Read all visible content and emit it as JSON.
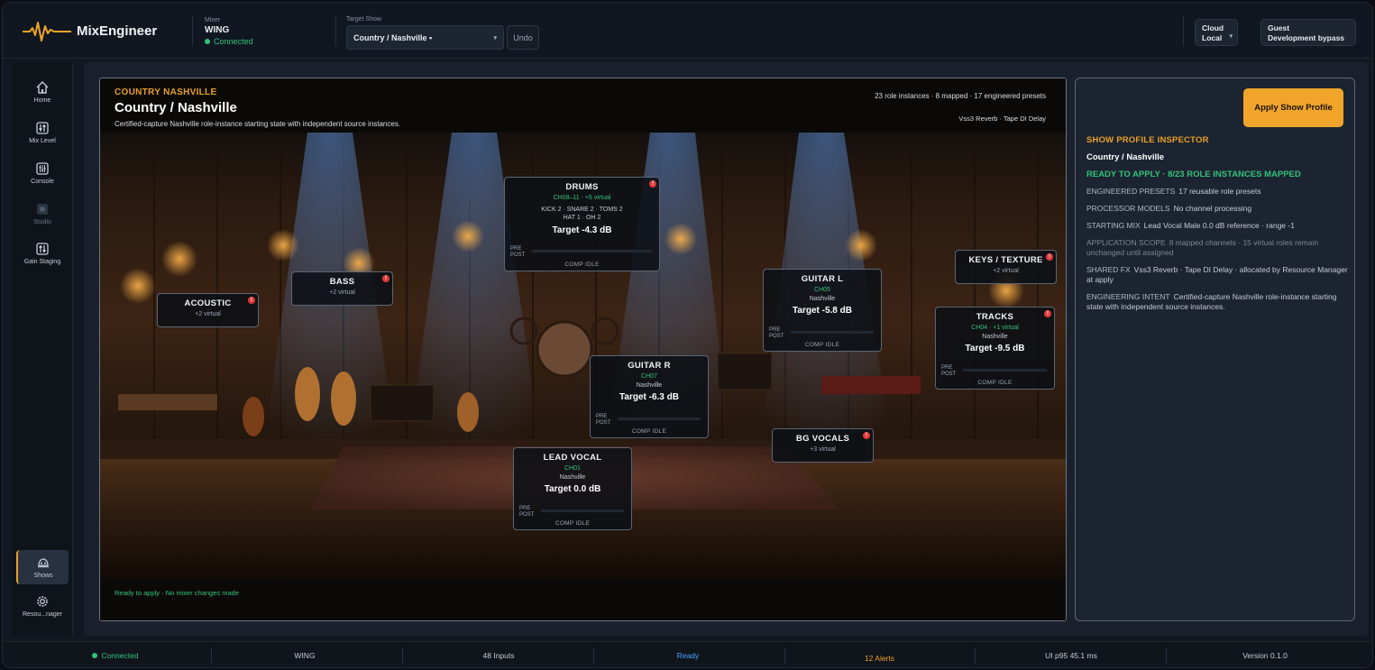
{
  "app": {
    "name": "MixEngineer"
  },
  "mixer": {
    "label": "Mixer",
    "name": "WING",
    "status": "Connected"
  },
  "target": {
    "label": "Target Show",
    "value": "Country / Nashville •",
    "undo": "Undo"
  },
  "cloud": {
    "line1": "Cloud",
    "line2": "Local"
  },
  "user": {
    "line1": "Guest",
    "line2": "Development bypass"
  },
  "sidebar": {
    "items": [
      {
        "label": "Home",
        "icon": "home-icon"
      },
      {
        "label": "Mix Level",
        "icon": "mix-level-icon"
      },
      {
        "label": "Console",
        "icon": "console-icon"
      },
      {
        "label": "Studio",
        "icon": "studio-icon"
      },
      {
        "label": "Gain Staging",
        "icon": "gain-staging-icon"
      },
      {
        "label": "Shows",
        "icon": "shows-icon"
      },
      {
        "label": "Resou...nager",
        "icon": "gear-icon"
      }
    ]
  },
  "show": {
    "genre": "COUNTRY NASHVILLE",
    "title": "Country / Nashville",
    "description": "Certified-capture Nashville role-instance starting state with independent source instances.",
    "stats": "23 role instances · 8 mapped · 17 engineered presets",
    "fx": "Vss3 Reverb · Tape DI Delay",
    "footer": "Ready to apply · No mixer changes made"
  },
  "roles": {
    "drums": {
      "name": "DRUMS",
      "channel": "CH08–11 · +5 virtual",
      "instances1": "KICK 2 · SNARE 2 · TOMS 2",
      "instances2": "HAT 1 · OH 2",
      "target": "Target -4.3 dB",
      "pre": "PRE",
      "post": "POST",
      "comp": "COMP IDLE",
      "alert": "!"
    },
    "bass": {
      "name": "BASS",
      "sub": "+2 virtual",
      "alert": "!"
    },
    "acoustic": {
      "name": "ACOUSTIC",
      "sub": "+2 virtual",
      "alert": "!"
    },
    "guitar_l": {
      "name": "GUITAR L",
      "channel": "CH05",
      "region": "Nashville",
      "target": "Target -5.8 dB",
      "pre": "PRE",
      "post": "POST",
      "comp": "COMP IDLE"
    },
    "keys": {
      "name": "KEYS / TEXTURE",
      "sub": "+2 virtual",
      "alert": "!"
    },
    "tracks": {
      "name": "TRACKS",
      "channel": "CH04 · +1 virtual",
      "region": "Nashville",
      "target": "Target -9.5 dB",
      "pre": "PRE",
      "post": "POST",
      "comp": "COMP IDLE",
      "alert": "!"
    },
    "guitar_r": {
      "name": "GUITAR R",
      "channel": "CH07",
      "region": "Nashville",
      "target": "Target -6.3 dB",
      "pre": "PRE",
      "post": "POST",
      "comp": "COMP IDLE"
    },
    "bg_vocals": {
      "name": "BG VOCALS",
      "sub": "+3 virtual",
      "alert": "!"
    },
    "lead_vocal": {
      "name": "LEAD VOCAL",
      "channel": "CH01",
      "region": "Nashville",
      "target": "Target 0.0 dB",
      "pre": "PRE",
      "post": "POST",
      "comp": "COMP IDLE"
    }
  },
  "inspector": {
    "apply": "Apply Show Profile",
    "heading": "SHOW PROFILE INSPECTOR",
    "name": "Country / Nashville",
    "ready": "READY TO APPLY · 8/23 ROLE INSTANCES MAPPED",
    "presets_k": "ENGINEERED PRESETS",
    "presets_v": "17 reusable role presets",
    "processor_k": "PROCESSOR MODELS",
    "processor_v": "No channel processing",
    "mix_k": "STARTING MIX",
    "mix_v": "Lead Vocal Male 0.0 dB reference · range -1",
    "scope_k": "APPLICATION SCOPE",
    "scope_v": "8 mapped channels · 15 virtual roles remain unchanged until assigned",
    "fx_k": "SHARED FX",
    "fx_v": "Vss3 Reverb · Tape DI Delay · allocated by Resource Manager at apply",
    "intent_k": "ENGINEERING INTENT",
    "intent_v": "Certified-capture Nashville role-instance starting state with independent source instances."
  },
  "status": {
    "connected": "Connected",
    "mixer": "WING",
    "inputs": "48 Inputs",
    "ready": "Ready",
    "alerts": "12 Alerts",
    "perf": "UI p95 45.1 ms",
    "version": "Version 0.1.0"
  },
  "colors": {
    "accent": "#e9a125",
    "ok": "#34c27a",
    "alert": "#e23b3b",
    "info": "#4aa3ff"
  }
}
